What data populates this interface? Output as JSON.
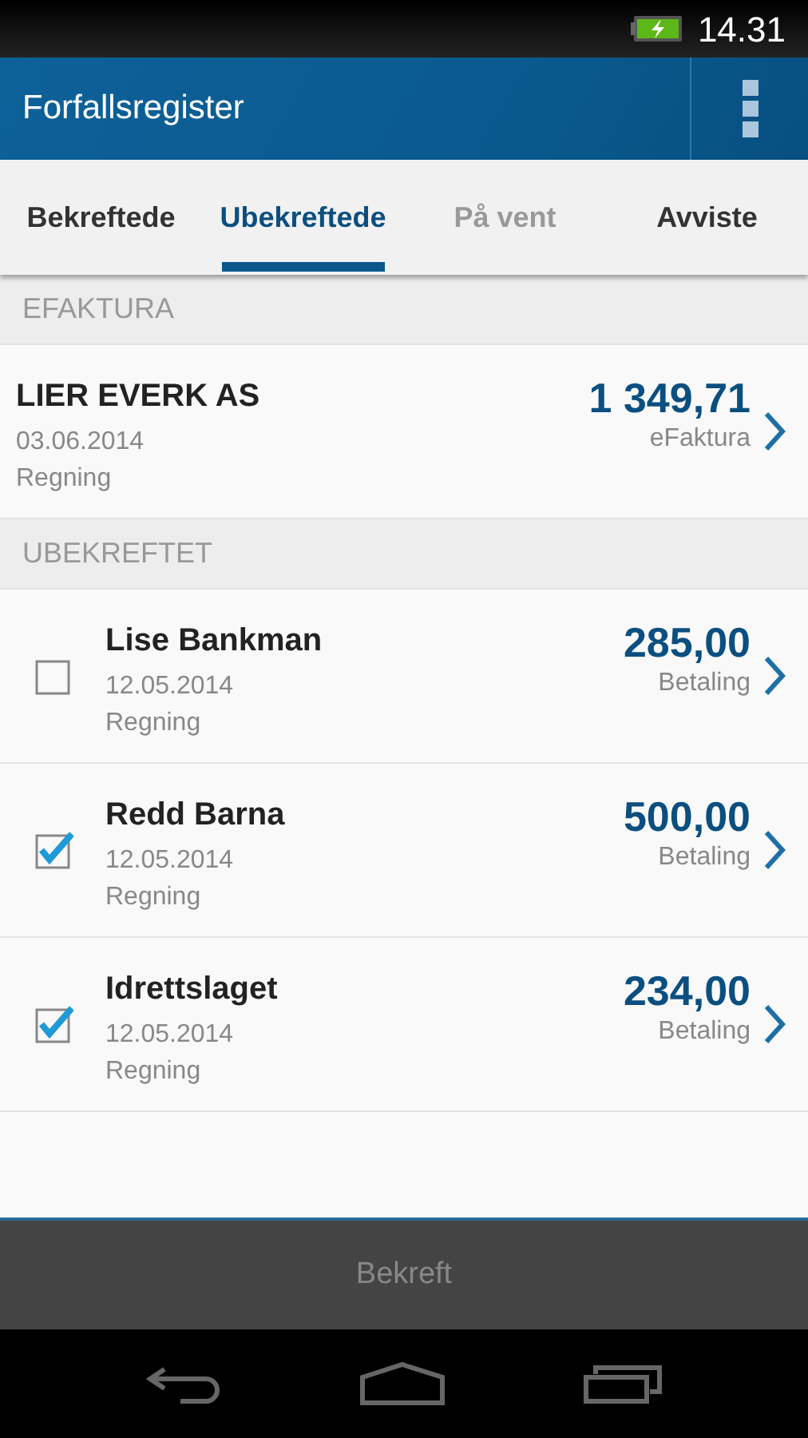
{
  "status_bar": {
    "time": "14.31"
  },
  "app_bar": {
    "title": "Forfallsregister"
  },
  "tabs": [
    {
      "label": "Bekreftede",
      "selected": false,
      "disabled": false
    },
    {
      "label": "Ubekreftede",
      "selected": true,
      "disabled": false
    },
    {
      "label": "På vent",
      "selected": false,
      "disabled": true
    },
    {
      "label": "Avviste",
      "selected": false,
      "disabled": false
    }
  ],
  "sections": [
    {
      "header": "EFAKTURA",
      "items": [
        {
          "kind": "plain",
          "name": "LIER EVERK AS",
          "date": "03.06.2014",
          "type": "Regning",
          "amount": "1 349,71",
          "method": "eFaktura"
        }
      ]
    },
    {
      "header": "UBEKREFTET",
      "items": [
        {
          "kind": "checkbox",
          "checked": false,
          "name": "Lise Bankman",
          "date": "12.05.2014",
          "type": "Regning",
          "amount": "285,00",
          "method": "Betaling"
        },
        {
          "kind": "checkbox",
          "checked": true,
          "name": "Redd Barna",
          "date": "12.05.2014",
          "type": "Regning",
          "amount": "500,00",
          "method": "Betaling"
        },
        {
          "kind": "checkbox",
          "checked": true,
          "name": "Idrettslaget",
          "date": "12.05.2014",
          "type": "Regning",
          "amount": "234,00",
          "method": "Betaling"
        }
      ]
    }
  ],
  "confirm_button": {
    "label": "Bekreft",
    "disabled": true
  }
}
